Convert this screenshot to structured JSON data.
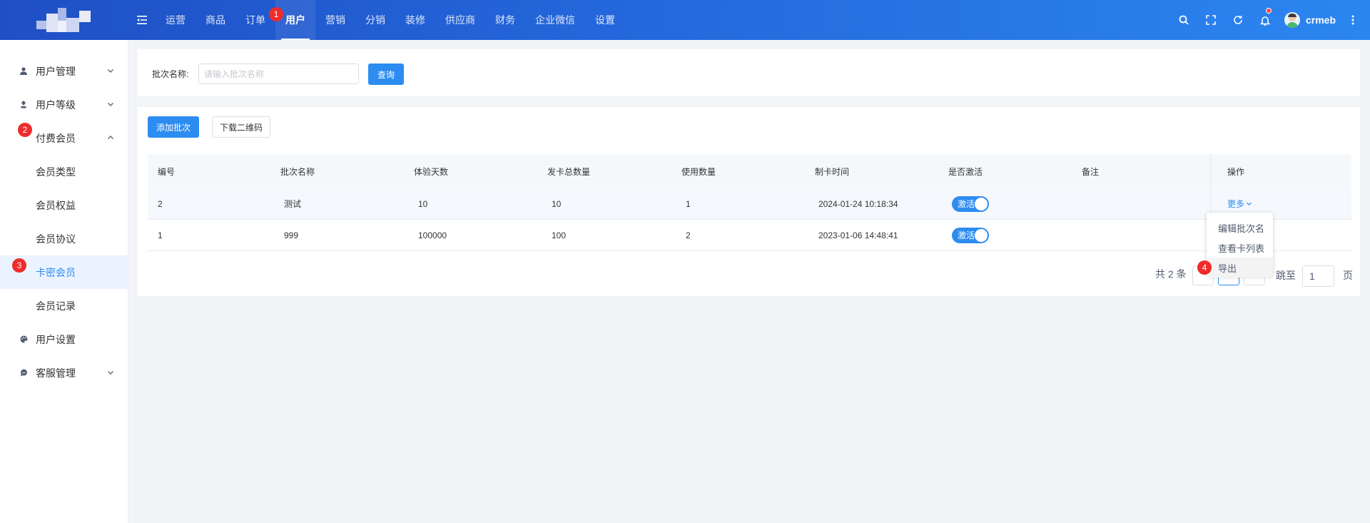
{
  "header": {
    "nav": [
      "运营",
      "商品",
      "订单",
      "用户",
      "营销",
      "分销",
      "装修",
      "供应商",
      "财务",
      "企业微信",
      "设置"
    ],
    "active_nav": "用户",
    "username": "crmeb"
  },
  "steps": [
    "1",
    "2",
    "3",
    "4"
  ],
  "sidebar": {
    "items": [
      {
        "label": "用户管理",
        "icon": "user-icon"
      },
      {
        "label": "用户等级",
        "icon": "level-icon"
      },
      {
        "label": "付费会员",
        "icon": "vip-icon"
      },
      {
        "label": "会员类型"
      },
      {
        "label": "会员权益"
      },
      {
        "label": "会员协议"
      },
      {
        "label": "卡密会员"
      },
      {
        "label": "会员记录"
      },
      {
        "label": "用户设置",
        "icon": "palette-icon"
      },
      {
        "label": "客服管理",
        "icon": "chat-icon"
      }
    ]
  },
  "search": {
    "label": "批次名称:",
    "placeholder": "请输入批次名称",
    "button": "查询"
  },
  "toolbar": {
    "add_batch": "添加批次",
    "download_qr": "下载二维码"
  },
  "table": {
    "columns": [
      "编号",
      "批次名称",
      "体验天数",
      "发卡总数量",
      "使用数量",
      "制卡时间",
      "是否激活",
      "备注",
      "操作"
    ],
    "rows": [
      {
        "id": "2",
        "name": "测试",
        "days": "10",
        "total": "10",
        "used": "1",
        "time": "2024-01-24 10:18:34",
        "active": "激活",
        "remark": "",
        "action": "更多"
      },
      {
        "id": "1",
        "name": "999",
        "days": "100000",
        "total": "100",
        "used": "2",
        "time": "2023-01-06 14:48:41",
        "active": "激活",
        "remark": "",
        "action": ""
      }
    ]
  },
  "dropdown": {
    "items": [
      "编辑批次名",
      "查看卡列表",
      "导出"
    ]
  },
  "pagination": {
    "total": "共 2 条",
    "goto": "跳至",
    "goto_value": "1",
    "page_suffix": "页"
  },
  "colors": {
    "primary": "#2d8cf0",
    "marker": "#ef2b2b",
    "header_start": "#1f4fc5",
    "header_end": "#2b86f0"
  }
}
